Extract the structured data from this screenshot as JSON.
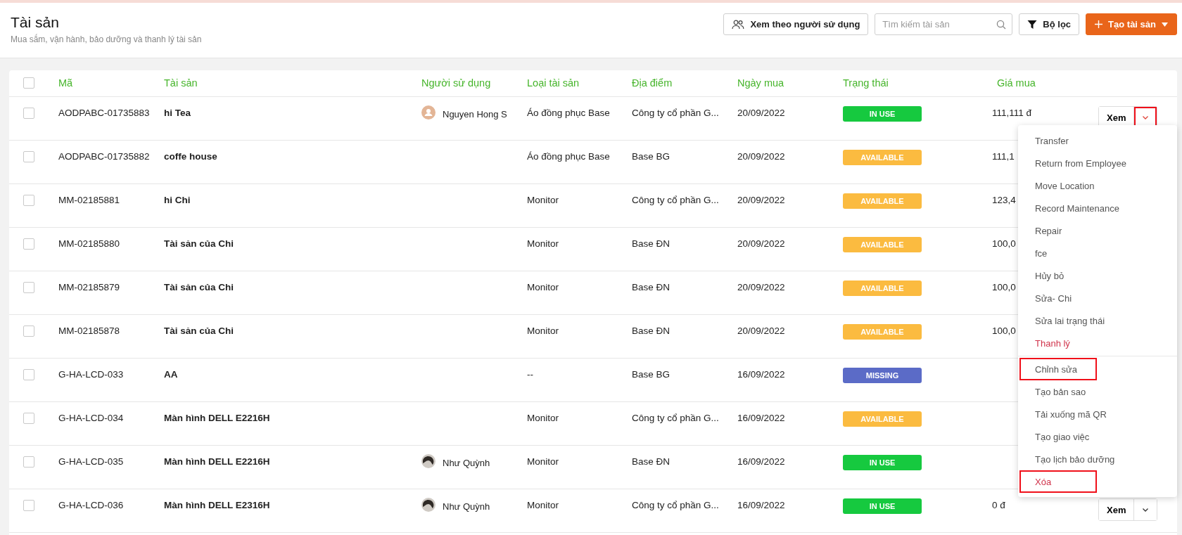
{
  "header": {
    "title": "Tài sản",
    "subtitle": "Mua sắm, vận hành, bảo dưỡng và thanh lý tài sản",
    "view_button": "Xem theo người sử dụng",
    "search": {
      "placeholder": "Tìm kiếm tài sản"
    },
    "filter_button": "Bộ lọc",
    "create_button": "Tạo tài sản"
  },
  "table": {
    "select_all": {
      "checked": false
    },
    "columns": [
      "Mã",
      "Tài sản",
      "Người sử dụng",
      "Loại tài sản",
      "Địa điểm",
      "Ngày mua",
      "Trạng thái",
      "Giá mua"
    ],
    "rows": [
      {
        "checked": false,
        "code": "AODPABC-01735883",
        "name": "hi Tea",
        "user": {
          "name": "Nguyen Hong S",
          "avatar": {
            "kind": "placeholder"
          }
        },
        "type": "Áo đồng phục Base",
        "location": "Công ty cổ phần G...",
        "date": "20/09/2022",
        "status": {
          "label": "IN USE",
          "kind": "in_use"
        },
        "price": "111,111 đ",
        "actions": {
          "label": "Xem",
          "highlighted": true
        }
      },
      {
        "checked": false,
        "code": "AODPABC-01735882",
        "name": "coffe house",
        "type": "Áo đồng phục Base",
        "location": "Base BG",
        "date": "20/09/2022",
        "status": {
          "label": "AVAILABLE",
          "kind": "available"
        },
        "price": "111,1"
      },
      {
        "checked": false,
        "code": "MM-02185881",
        "name": "hi Chi",
        "type": "Monitor",
        "location": "Công ty cổ phần G...",
        "date": "20/09/2022",
        "status": {
          "label": "AVAILABLE",
          "kind": "available"
        },
        "price": "123,4"
      },
      {
        "checked": false,
        "code": "MM-02185880",
        "name": "Tài sản của Chi",
        "type": "Monitor",
        "location": "Base ĐN",
        "date": "20/09/2022",
        "status": {
          "label": "AVAILABLE",
          "kind": "available"
        },
        "price": "100,0"
      },
      {
        "checked": false,
        "code": "MM-02185879",
        "name": "Tài sản của Chi",
        "type": "Monitor",
        "location": "Base ĐN",
        "date": "20/09/2022",
        "status": {
          "label": "AVAILABLE",
          "kind": "available"
        },
        "price": "100,0"
      },
      {
        "checked": false,
        "code": "MM-02185878",
        "name": "Tài sản của Chi",
        "type": "Monitor",
        "location": "Base ĐN",
        "date": "20/09/2022",
        "status": {
          "label": "AVAILABLE",
          "kind": "available"
        },
        "price": "100,0"
      },
      {
        "checked": false,
        "code": "G-HA-LCD-033",
        "name": "AA",
        "type": "--",
        "location": "Base BG",
        "date": "16/09/2022",
        "status": {
          "label": "MISSING",
          "kind": "missing"
        }
      },
      {
        "checked": false,
        "code": "G-HA-LCD-034",
        "name": "Màn hình DELL E2216H",
        "type": "Monitor",
        "location": "Công ty cổ phần G...",
        "date": "16/09/2022",
        "status": {
          "label": "AVAILABLE",
          "kind": "available"
        }
      },
      {
        "checked": false,
        "code": "G-HA-LCD-035",
        "name": "Màn hình DELL E2216H",
        "user": {
          "name": "Như Quỳnh",
          "avatar": {
            "kind": "photo"
          }
        },
        "type": "Monitor",
        "location": "Base ĐN",
        "date": "16/09/2022",
        "status": {
          "label": "IN USE",
          "kind": "in_use"
        }
      },
      {
        "checked": false,
        "code": "G-HA-LCD-036",
        "name": "Màn hình DELL E2316H",
        "user": {
          "name": "Như Quỳnh",
          "avatar": {
            "kind": "photo"
          }
        },
        "type": "Monitor",
        "location": "Công ty cổ phần G...",
        "date": "16/09/2022",
        "status": {
          "label": "IN USE",
          "kind": "in_use"
        },
        "price": "0 đ",
        "actions": {
          "label": "Xem",
          "highlighted": false
        }
      }
    ]
  },
  "row_menu": {
    "items": [
      {
        "label": "Transfer",
        "danger": false,
        "highlighted": false,
        "divider_after": false
      },
      {
        "label": "Return from Employee",
        "danger": false,
        "highlighted": false,
        "divider_after": false
      },
      {
        "label": "Move Location",
        "danger": false,
        "highlighted": false,
        "divider_after": false
      },
      {
        "label": "Record Maintenance",
        "danger": false,
        "highlighted": false,
        "divider_after": false
      },
      {
        "label": "Repair",
        "danger": false,
        "highlighted": false,
        "divider_after": false
      },
      {
        "label": "fce",
        "danger": false,
        "highlighted": false,
        "divider_after": false
      },
      {
        "label": "Hủy bỏ",
        "danger": false,
        "highlighted": false,
        "divider_after": false
      },
      {
        "label": "Sửa- Chi",
        "danger": false,
        "highlighted": false,
        "divider_after": false
      },
      {
        "label": "Sửa lai trạng thái",
        "danger": false,
        "highlighted": false,
        "divider_after": false
      },
      {
        "label": "Thanh lý",
        "danger": true,
        "highlighted": false,
        "divider_after": true
      },
      {
        "label": "Chỉnh sửa",
        "danger": false,
        "highlighted": true,
        "divider_after": false
      },
      {
        "label": "Tạo bản sao",
        "danger": false,
        "highlighted": false,
        "divider_after": false
      },
      {
        "label": "Tải xuống mã QR",
        "danger": false,
        "highlighted": false,
        "divider_after": false
      },
      {
        "label": "Tạo giao việc",
        "danger": false,
        "highlighted": false,
        "divider_after": false
      },
      {
        "label": "Tạo lịch bảo dưỡng",
        "danger": false,
        "highlighted": false,
        "divider_after": false
      },
      {
        "label": "Xóa",
        "danger": true,
        "highlighted": true,
        "divider_after": false
      }
    ]
  }
}
